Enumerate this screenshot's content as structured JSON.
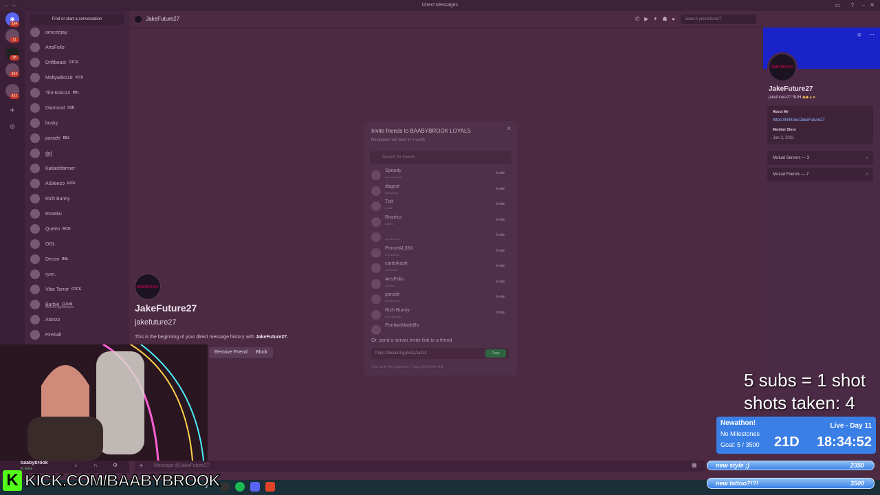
{
  "window": {
    "title": "Direct Messages",
    "back_glyph": "←  →"
  },
  "servers": {
    "badges": [
      "164",
      "11",
      "98",
      "914",
      "417"
    ]
  },
  "dm_list": {
    "find_placeholder": "Find or start a conversation",
    "items": [
      {
        "name": "iamceejay.",
        "tag": ""
      },
      {
        "name": "ArtsFolio",
        "tag": ""
      },
      {
        "name": "Driftbeast",
        "tag": "OTCS"
      },
      {
        "name": "Mollywilko18",
        "tag": "KICK"
      },
      {
        "name": "Tim-toxic14",
        "tag": "BBL"
      },
      {
        "name": "Diamond",
        "tag": "SSB"
      },
      {
        "name": "husky",
        "tag": ""
      },
      {
        "name": "parade",
        "tag": "BBL"
      },
      {
        "name": "del",
        "tag": "",
        "sub": "all in"
      },
      {
        "name": "Kailashfarmer",
        "tag": ""
      },
      {
        "name": "AiSteezo",
        "tag": "KICK"
      },
      {
        "name": "Rich Bunny",
        "tag": ""
      },
      {
        "name": "Roseku",
        "tag": ""
      },
      {
        "name": "Queen",
        "tag": "MCG"
      },
      {
        "name": "OGL",
        "tag": ""
      },
      {
        "name": "Decon",
        "tag": "BBL"
      },
      {
        "name": "ryxn.",
        "tag": ""
      },
      {
        "name": "Vibe Terror",
        "tag": "OTCS"
      },
      {
        "name": "Barbie",
        "tag": "CUUM",
        "sub": "discord.gg/lifestyle"
      },
      {
        "name": "Alonzo",
        "tag": ""
      },
      {
        "name": "Fireball",
        "tag": ""
      }
    ]
  },
  "header": {
    "channel_name": "JakeFuture27",
    "search_placeholder": "Search jakefuture27"
  },
  "intro": {
    "avatar_text": "BABYBROOK",
    "display_name": "JakeFuture27",
    "username": "jakefuture27",
    "history_prefix": "This is the beginning of your direct message history with",
    "history_name": "JakeFuture27.",
    "remove_friend": "Remove Friend",
    "block": "Block"
  },
  "composer": {
    "placeholder": "Message @JakeFuture27"
  },
  "user_panel": {
    "name": "baabybrook",
    "status": "In voice"
  },
  "invite_modal": {
    "title": "Invite friends to BAABYBROOK LOYALS",
    "hint": "Recipients will land in",
    "channel": "verify",
    "search_placeholder": "Search for friends",
    "invite_label": "Invite",
    "friends": [
      {
        "name": "Speedy",
        "user": "speedygoodly"
      },
      {
        "name": "dagost",
        "user": "officialdaily"
      },
      {
        "name": "Tutt",
        "user": "tuttaiii"
      },
      {
        "name": "Roseku",
        "user": "roseku"
      },
      {
        "name": "",
        "user": "subversiveo"
      },
      {
        "name": "PrinceAL33X",
        "user": "princeal33x"
      },
      {
        "name": "carterkash",
        "user": "carterkash"
      },
      {
        "name": "ArtsFolio",
        "user": "artsfolio"
      },
      {
        "name": "parade",
        "user": "paradeloudy"
      },
      {
        "name": "Rich Bunny",
        "user": "therichbunny"
      },
      {
        "name": "PontiacMadeBo",
        "user": ""
      }
    ],
    "or_text": "Or, send a server invite link to a friend",
    "invite_link": "https://discord.gg/vsQAa2Ut",
    "copy": "Copy",
    "expiry": "Your invite link expires in 7 days. Edit invite link."
  },
  "profile": {
    "avatar_text": "BABYBROOK",
    "display_name": "JakeFuture27",
    "username": "jakefuture27",
    "tag": "SUH",
    "about_label": "About Me",
    "about_link": "https://linktree/JakeFuture27",
    "member_since_label": "Member Since",
    "member_since": "Jun 3, 2021",
    "mutual_servers": "Mutual Servers — 3",
    "mutual_friends": "Mutual Friends — 7"
  },
  "stream_overlay": {
    "subs_line1": "5 subs = 1 shot",
    "subs_line2": "shots taken: 4",
    "subathon_title": "Newathon!",
    "milestones": "No Milestones",
    "goal": "Goal: 5 / 3500",
    "live_day": "Live - Day 11",
    "timer_days": "21D",
    "timer_clock": "18:34:52",
    "goal1_label": "new style ;)",
    "goal1_value": "2350",
    "goal2_label": "new tattoo?!?!",
    "goal2_value": "3500",
    "kick_banner": "KICK.COM/BAABYBROOK"
  },
  "colors": {
    "background": "#4b2a42",
    "accent_blue": "#3a7fe6",
    "kick_green": "#53fc18",
    "copy_green": "#2d6b3f"
  }
}
